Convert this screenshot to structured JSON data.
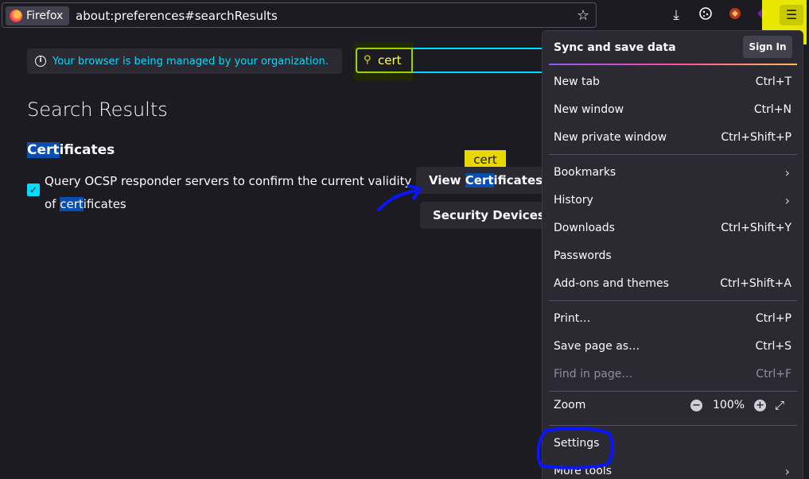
{
  "browser": {
    "identity_label": "Firefox",
    "url": "about:preferences#searchResults"
  },
  "icons": {
    "star": "bookmark-star-icon",
    "download": "download-icon",
    "extension1": "cookie-icon",
    "extension2": "extension-icon",
    "extension3": "extension-icon",
    "menu": "hamburger-menu-icon"
  },
  "prefs": {
    "managed_notice": "Your browser is being managed by your organization.",
    "search_value": "cert",
    "page_title": "Search Results",
    "section_title_hl": "Cert",
    "section_title_rest": "ificates",
    "ocsp_label_start": "Query OCSP responder servers to confirm the current validity of ",
    "ocsp_label_hl": "cert",
    "ocsp_label_rest": "ificates",
    "view_cert_pre": "View ",
    "view_cert_hl": "Cert",
    "view_cert_rest": "ificates…",
    "security_devices": "Security Devices…",
    "tooltip": "cert"
  },
  "menu": {
    "header": "Sync and save data",
    "signin": "Sign In",
    "new_tab": {
      "label": "New tab",
      "shortcut": "Ctrl+T"
    },
    "new_window": {
      "label": "New window",
      "shortcut": "Ctrl+N"
    },
    "new_private": {
      "label": "New private window",
      "shortcut": "Ctrl+Shift+P"
    },
    "bookmarks": {
      "label": "Bookmarks"
    },
    "history": {
      "label": "History"
    },
    "downloads": {
      "label": "Downloads",
      "shortcut": "Ctrl+Shift+Y"
    },
    "passwords": {
      "label": "Passwords"
    },
    "addons": {
      "label": "Add-ons and themes",
      "shortcut": "Ctrl+Shift+A"
    },
    "print": {
      "label": "Print…",
      "shortcut": "Ctrl+P"
    },
    "save_page": {
      "label": "Save page as…",
      "shortcut": "Ctrl+S"
    },
    "find": {
      "label": "Find in page…",
      "shortcut": "Ctrl+F"
    },
    "zoom": {
      "label": "Zoom",
      "value": "100%"
    },
    "settings": {
      "label": "Settings"
    },
    "more_tools": {
      "label": "More tools"
    }
  },
  "colors": {
    "accent": "#00ddff",
    "highlight_yellow": "#f2f200",
    "annotation_blue": "#0a14ff"
  }
}
